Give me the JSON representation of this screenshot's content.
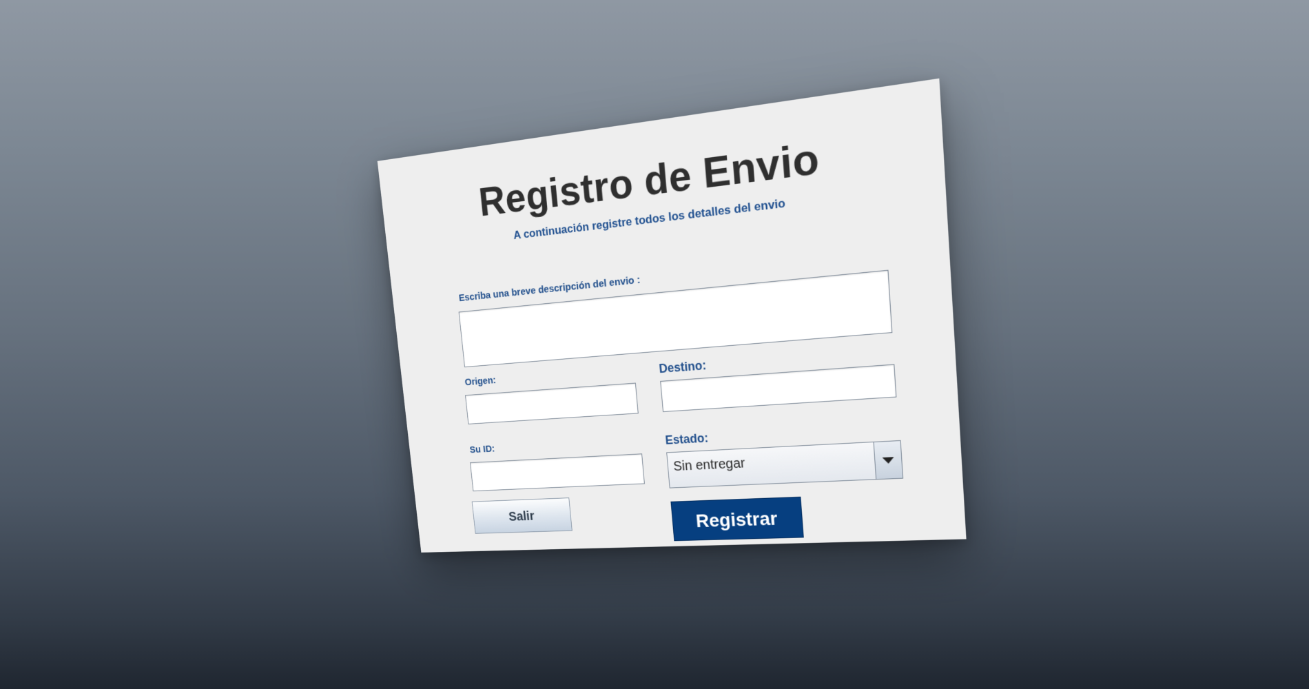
{
  "form": {
    "title": "Registro de Envio",
    "subtitle": "A continuación registre todos los detalles del envio",
    "description_label": "Escriba una breve descripción del envio :",
    "description_value": "",
    "origin_label": "Origen:",
    "origin_value": "",
    "destination_label": "Destino:",
    "destination_value": "",
    "id_label": "Su ID:",
    "id_value": "",
    "status_label": "Estado:",
    "status_selected": "Sin entregar",
    "exit_button_label": "Salir",
    "register_button_label": "Registrar"
  },
  "icons": {
    "status_dropdown": "chevron-down-icon"
  },
  "colors": {
    "label_text": "#214f8c",
    "title_text": "#2f2f2f",
    "panel_background": "#eeeeee",
    "primary_button": "#063f80",
    "primary_button_text": "#ffffff"
  }
}
